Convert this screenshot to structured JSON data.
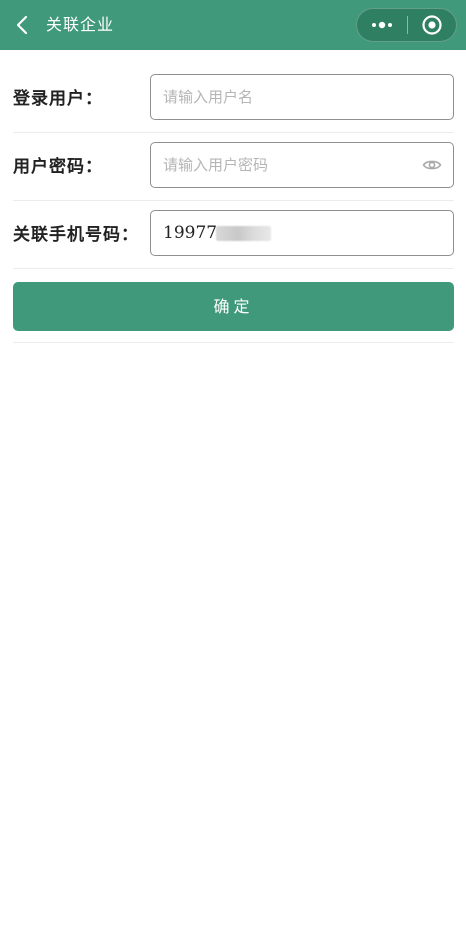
{
  "header": {
    "title": "关联企业",
    "back_icon": "chevron-left-icon",
    "more_icon": "more-dots-icon",
    "close_icon": "target-circle-icon",
    "background_color": "#3f997a"
  },
  "form": {
    "username": {
      "label": "登录用户：",
      "value": "",
      "placeholder": "请输入用户名"
    },
    "password": {
      "label": "用户密码：",
      "value": "",
      "placeholder": "请输入用户密码",
      "toggle_icon": "eye-icon"
    },
    "phone": {
      "label": "关联手机号码：",
      "value": "19977"
    }
  },
  "submit": {
    "label": "确定",
    "color": "#3f997a"
  }
}
